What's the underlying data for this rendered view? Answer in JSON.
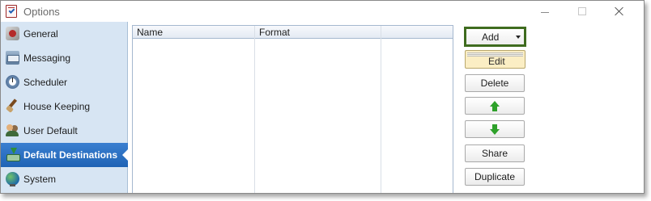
{
  "window": {
    "title": "Options",
    "controls": {
      "minimize": "minimize",
      "maximize": "maximize",
      "close": "close"
    }
  },
  "sidebar": {
    "items": [
      {
        "label": "General",
        "icon": "general-icon",
        "selected": false
      },
      {
        "label": "Messaging",
        "icon": "messaging-icon",
        "selected": false
      },
      {
        "label": "Scheduler",
        "icon": "scheduler-icon",
        "selected": false
      },
      {
        "label": "House Keeping",
        "icon": "broom-icon",
        "selected": false
      },
      {
        "label": "User Default",
        "icon": "users-icon",
        "selected": false
      },
      {
        "label": "Default Destinations",
        "icon": "destination-icon",
        "selected": true
      },
      {
        "label": "System",
        "icon": "globe-icon",
        "selected": false
      }
    ]
  },
  "grid": {
    "columns": [
      "Name",
      "Format",
      ""
    ],
    "rows": []
  },
  "buttons": {
    "add_label": "Add",
    "edit_label": "Edit",
    "delete_label": "Delete",
    "move_up_icon": "arrow-up-icon",
    "move_down_icon": "arrow-down-icon",
    "share_label": "Share",
    "duplicate_label": "Duplicate"
  },
  "colors": {
    "sidebar_bg": "#d7e5f3",
    "selected_bg": "#2a6fc4",
    "add_focus_border": "#3f6c1f",
    "edit_hover_bg": "#fbeec4",
    "arrow_green": "#2ea12a"
  }
}
